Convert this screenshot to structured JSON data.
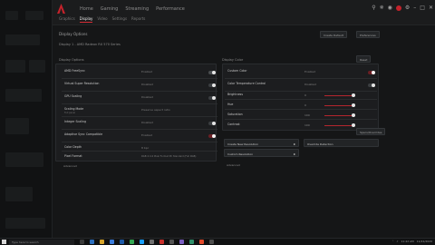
{
  "colors": {
    "accent": "#c4222b",
    "panel": "#1c1d1f",
    "background": "#151617"
  },
  "topnav": {
    "items": [
      "Home",
      "Gaming",
      "Streaming",
      "Performance"
    ]
  },
  "subnav": {
    "items": [
      "Graphics",
      "Display",
      "Video",
      "Settings",
      "Reports"
    ]
  },
  "header": {
    "title": "Display Options",
    "subtitle": "Display 1 - AMD Radeon RX 570 Series",
    "btn_left": "Create Default",
    "btn_right": "Preferences"
  },
  "display_options": {
    "section_label": "Display Options",
    "rows": [
      {
        "label": "AMD FreeSync",
        "sub": "",
        "value": "Enabled",
        "toggle": "on"
      },
      {
        "label": "Virtual Super Resolution",
        "sub": "",
        "value": "Disabled",
        "toggle": "off"
      },
      {
        "label": "GPU Scaling",
        "sub": "",
        "value": "Disabled",
        "toggle": "off"
      },
      {
        "label": "Scaling Mode",
        "sub": "Full panel",
        "value": "Preserve aspect ratio",
        "toggle": ""
      },
      {
        "label": "Integer Scaling",
        "sub": "",
        "value": "Disabled",
        "toggle": "off"
      },
      {
        "label": "Adaptive Sync Compatible",
        "sub": "",
        "value": "Enabled",
        "toggle": "red"
      },
      {
        "label": "Color Depth",
        "sub": "",
        "value": "8 bpc",
        "toggle": ""
      },
      {
        "label": "Pixel Format",
        "sub": "",
        "value": "RGB 4:4:4 Pixel Format PC Standard (Full RGB)",
        "toggle": ""
      }
    ],
    "more_link": "Advanced"
  },
  "display_color": {
    "section_label": "Display Color",
    "reset_label": "Reset",
    "custom_color": {
      "label": "Custom Color",
      "value": "Enabled"
    },
    "color_temp_control": {
      "label": "Color Temperature Control",
      "value": "Disabled"
    },
    "sliders": [
      {
        "label": "Brightness",
        "value": 0,
        "fill": 0.5
      },
      {
        "label": "Hue",
        "value": 0,
        "fill": 0.5
      },
      {
        "label": "Saturation",
        "value": 100,
        "fill": 0.5
      },
      {
        "label": "Contrast",
        "value": 100,
        "fill": 0.5
      }
    ]
  },
  "custom_resolutions": {
    "items": [
      {
        "label": "Create New Resolution"
      },
      {
        "label": "Custom Resolution"
      }
    ],
    "more_link": "Advanced",
    "override": "Specs/Overrides"
  },
  "override_panel": {
    "label": "Override Detection"
  },
  "taskbar": {
    "search_placeholder": "Type here to search",
    "time": "11:42 AM",
    "date": "11/22/2020"
  }
}
